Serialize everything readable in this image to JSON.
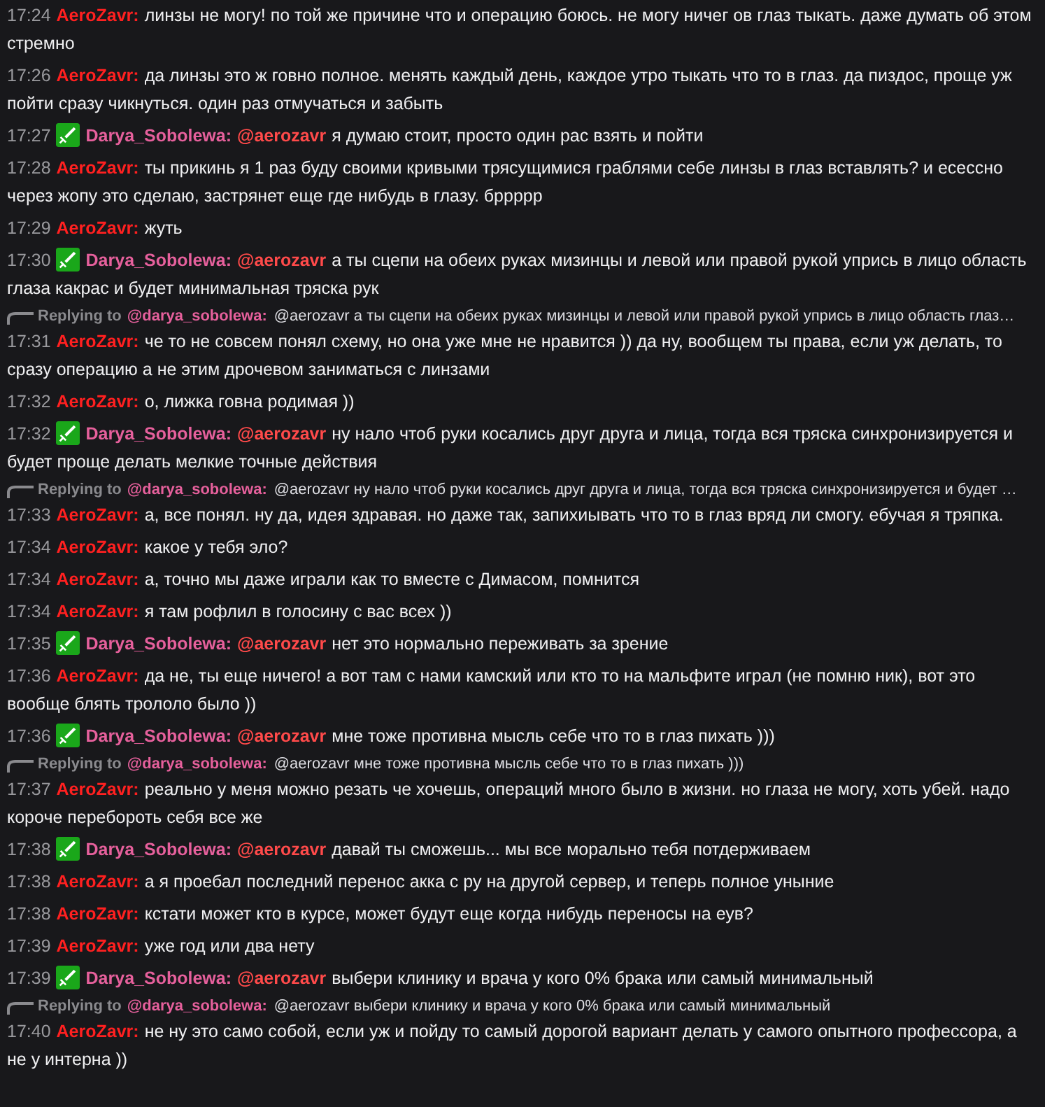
{
  "messages": [
    {
      "time": "17:24",
      "badge": false,
      "user": "AeroZavr:",
      "color": "#ff2020",
      "text": "линзы не могу! по той же причине что и операцию боюсь. не могу ничег ов глаз тыкать. даже думать об этом стремно"
    },
    {
      "time": "17:26",
      "badge": false,
      "user": "AeroZavr:",
      "color": "#ff2020",
      "text": "да линзы это ж говно полное. менять каждый день, каждое утро тыкать что то в глаз. да пиздос, проще уж пойти сразу чикнуться. один раз отмучаться и забыть"
    },
    {
      "time": "17:27",
      "badge": true,
      "user": "Darya_Sobolewa:",
      "color": "#e6609c",
      "mention": "@aerozavr",
      "text": "я думаю стоит, просто один рас взять и пойти"
    },
    {
      "time": "17:28",
      "badge": false,
      "user": "AeroZavr:",
      "color": "#ff2020",
      "text": "ты прикинь я 1 раз буду своими кривыми трясущимися граблями себе линзы в глаз вставлять? и есессно через жопу это сделаю, застрянет еще где нибудь в глазу. бррррр"
    },
    {
      "time": "17:29",
      "badge": false,
      "user": "AeroZavr:",
      "color": "#ff2020",
      "text": "жуть"
    },
    {
      "time": "17:30",
      "badge": true,
      "user": "Darya_Sobolewa:",
      "color": "#e6609c",
      "mention": "@aerozavr",
      "text": "а ты сцепи на обеих руках мизинцы и левой или правой рукой упрись в лицо область глаза какрас и будет минимальная тряска рук"
    },
    {
      "time": "17:31",
      "badge": false,
      "user": "AeroZavr:",
      "color": "#ff2020",
      "reply": {
        "label": "Replying to",
        "user": "@darya_sobolewa:",
        "text": "@aerozavr а ты сцепи на обеих руках мизинцы и левой или правой рукой упрись в лицо область глаз…"
      },
      "text": "че то не совсем понял схему, но она уже мне не нравится )) да ну, вообщем ты права, если уж делать, то сразу операцию а не этим дрочевом заниматься с линзами"
    },
    {
      "time": "17:32",
      "badge": false,
      "user": "AeroZavr:",
      "color": "#ff2020",
      "text": "о, лижка говна родимая ))"
    },
    {
      "time": "17:32",
      "badge": true,
      "user": "Darya_Sobolewa:",
      "color": "#e6609c",
      "mention": "@aerozavr",
      "text": "ну нало чтоб руки косались друг друга и лица, тогда вся тряска синхронизируется и будет проще делать мелкие точные действия"
    },
    {
      "time": "17:33",
      "badge": false,
      "user": "AeroZavr:",
      "color": "#ff2020",
      "reply": {
        "label": "Replying to",
        "user": "@darya_sobolewa:",
        "text": "@aerozavr ну нало чтоб руки косались друг друга и лица, тогда вся тряска синхронизируется и будет …"
      },
      "text": "а, все понял. ну да, идея здравая. но даже так, запихиывать что то в глаз вряд ли смогу. ебучая я тряпка."
    },
    {
      "time": "17:34",
      "badge": false,
      "user": "AeroZavr:",
      "color": "#ff2020",
      "text": "какое у тебя эло?"
    },
    {
      "time": "17:34",
      "badge": false,
      "user": "AeroZavr:",
      "color": "#ff2020",
      "text": "а, точно мы даже играли как то вместе с Димасом, помнится"
    },
    {
      "time": "17:34",
      "badge": false,
      "user": "AeroZavr:",
      "color": "#ff2020",
      "text": "я там рофлил в голосину с вас всех ))"
    },
    {
      "time": "17:35",
      "badge": true,
      "user": "Darya_Sobolewa:",
      "color": "#e6609c",
      "mention": "@aerozavr",
      "text": "нет это нормально переживать за зрение"
    },
    {
      "time": "17:36",
      "badge": false,
      "user": "AeroZavr:",
      "color": "#ff2020",
      "text": "да не, ты еще ничего! а вот там с нами камский или кто то на мальфите играл (не помню ник), вот это вообще блять трололо было ))"
    },
    {
      "time": "17:36",
      "badge": true,
      "user": "Darya_Sobolewa:",
      "color": "#e6609c",
      "mention": "@aerozavr",
      "text": "мне тоже противна мысль себе что то в глаз пихать )))"
    },
    {
      "time": "17:37",
      "badge": false,
      "user": "AeroZavr:",
      "color": "#ff2020",
      "reply": {
        "label": "Replying to",
        "user": "@darya_sobolewa:",
        "text": "@aerozavr мне тоже противна мысль себе что то в глаз пихать )))"
      },
      "text": "реально у меня можно резать че хочешь, операций много было в жизни. но глаза не могу, хоть убей. надо короче перебороть себя все же"
    },
    {
      "time": "17:38",
      "badge": true,
      "user": "Darya_Sobolewa:",
      "color": "#e6609c",
      "mention": "@aerozavr",
      "text": "давай ты сможешь... мы все морально тебя потдерживаем"
    },
    {
      "time": "17:38",
      "badge": false,
      "user": "AeroZavr:",
      "color": "#ff2020",
      "text": "а я проебал последний перенос акка с ру на другой сервер, и теперь полное уныние"
    },
    {
      "time": "17:38",
      "badge": false,
      "user": "AeroZavr:",
      "color": "#ff2020",
      "text": "кстати может кто в курсе, может будут еще когда нибудь переносы на еув?"
    },
    {
      "time": "17:39",
      "badge": false,
      "user": "AeroZavr:",
      "color": "#ff2020",
      "text": "уже год или два нету"
    },
    {
      "time": "17:39",
      "badge": true,
      "user": "Darya_Sobolewa:",
      "color": "#e6609c",
      "mention": "@aerozavr",
      "text": "выбери клинику и врача у кого 0% брака или самый минимальный"
    },
    {
      "time": "17:40",
      "badge": false,
      "user": "AeroZavr:",
      "color": "#ff2020",
      "reply": {
        "label": "Replying to",
        "user": "@darya_sobolewa:",
        "text": "@aerozavr выбери клинику и врача у кого 0% брака или самый минимальный"
      },
      "text": "не ну это само собой, если уж и пойду то самый дорогой вариант делать у самого опытного профессора, а не у интерна ))"
    }
  ]
}
